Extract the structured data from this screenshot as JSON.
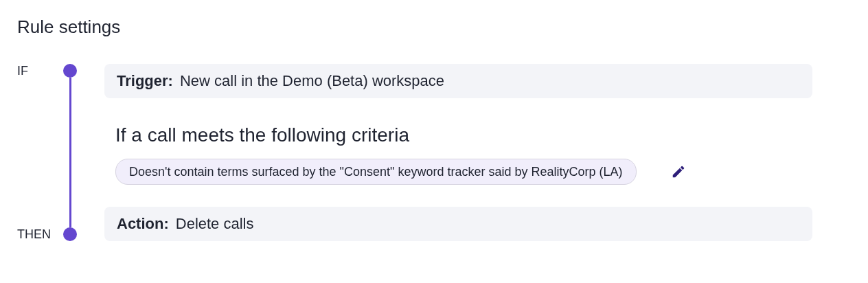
{
  "title": "Rule settings",
  "rail": {
    "start_label": "IF",
    "end_label": "THEN"
  },
  "trigger": {
    "label": "Trigger:",
    "value": "New call in the Demo (Beta) workspace"
  },
  "criteria": {
    "heading": "If a call meets the following criteria",
    "chips": [
      "Doesn't contain terms surfaced by the \"Consent\" keyword tracker said by RealityCorp (LA)"
    ]
  },
  "action": {
    "label": "Action:",
    "value": "Delete calls"
  }
}
